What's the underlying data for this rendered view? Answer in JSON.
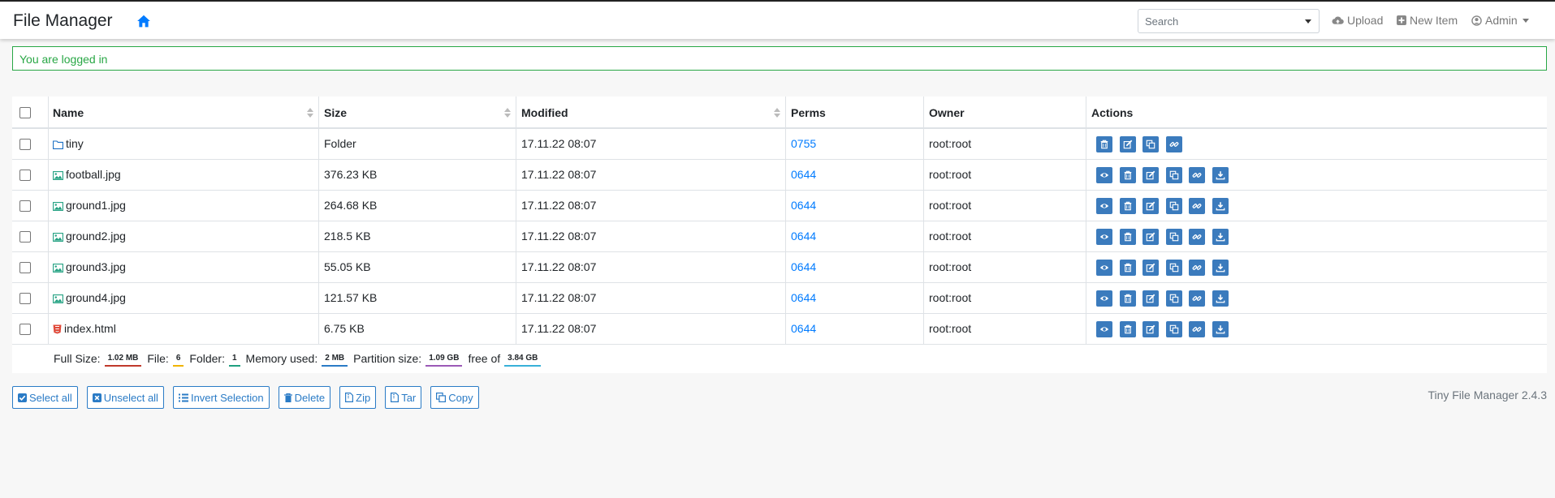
{
  "app": {
    "title": "File Manager",
    "version": "Tiny File Manager 2.4.3"
  },
  "search": {
    "placeholder": "Search"
  },
  "nav": {
    "upload": "Upload",
    "new_item": "New Item",
    "user": "Admin"
  },
  "alert": {
    "message": "You are logged in"
  },
  "table": {
    "headers": [
      "Name",
      "Size",
      "Modified",
      "Perms",
      "Owner",
      "Actions"
    ],
    "rows": [
      {
        "name": "tiny",
        "type": "folder",
        "size": "Folder",
        "modified": "17.11.22 08:07",
        "perms": "0755",
        "owner": "root:root"
      },
      {
        "name": "football.jpg",
        "type": "image",
        "size": "376.23 KB",
        "modified": "17.11.22 08:07",
        "perms": "0644",
        "owner": "root:root"
      },
      {
        "name": "ground1.jpg",
        "type": "image",
        "size": "264.68 KB",
        "modified": "17.11.22 08:07",
        "perms": "0644",
        "owner": "root:root"
      },
      {
        "name": "ground2.jpg",
        "type": "image",
        "size": "218.5 KB",
        "modified": "17.11.22 08:07",
        "perms": "0644",
        "owner": "root:root"
      },
      {
        "name": "ground3.jpg",
        "type": "image",
        "size": "55.05 KB",
        "modified": "17.11.22 08:07",
        "perms": "0644",
        "owner": "root:root"
      },
      {
        "name": "ground4.jpg",
        "type": "image",
        "size": "121.57 KB",
        "modified": "17.11.22 08:07",
        "perms": "0644",
        "owner": "root:root"
      },
      {
        "name": "index.html",
        "type": "html",
        "size": "6.75 KB",
        "modified": "17.11.22 08:07",
        "perms": "0644",
        "owner": "root:root"
      }
    ]
  },
  "stats": {
    "full_size_label": "Full Size:",
    "full_size": "1.02 MB",
    "file_label": "File:",
    "file_count": "6",
    "folder_label": "Folder:",
    "folder_count": "1",
    "memory_label": "Memory used:",
    "memory": "2 MB",
    "partition_label": "Partition size:",
    "partition": "1.09 GB",
    "free_label": "free of",
    "total": "3.84 GB"
  },
  "buttons": {
    "select_all": "Select all",
    "unselect_all": "Unselect all",
    "invert": "Invert Selection",
    "delete": "Delete",
    "zip": "Zip",
    "tar": "Tar",
    "copy": "Copy"
  },
  "colors": {
    "accent": "#007bff",
    "action_button": "#3b7bbd",
    "success": "#28a745",
    "badge_full_size": "#c0392b",
    "badge_file": "#f0b400",
    "badge_folder": "#20a080",
    "badge_memory": "#2a7bc6",
    "badge_partition": "#9b59b6",
    "badge_total": "#38b0d8"
  }
}
